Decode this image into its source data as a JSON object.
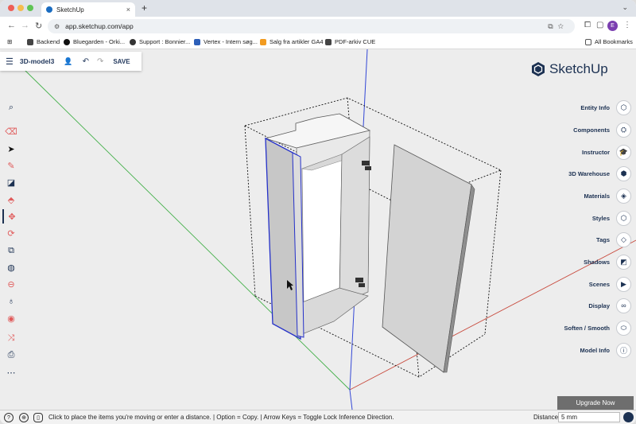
{
  "browser": {
    "tab_title": "SketchUp",
    "tab_close": "×",
    "new_tab": "+",
    "tab_menu": "⌄",
    "url": "app.sketchup.com/app",
    "avatar_initial": "E",
    "bookmarks": [
      "Backend",
      "Bluegarden - Orki...",
      "Support : Bonnier...",
      "Vertex - Intern søg...",
      "Salg fra artikler GA4",
      "PDF-arkiv CUE"
    ],
    "all_bookmarks": "All Bookmarks"
  },
  "app": {
    "file_name": "3D-model3",
    "save_label": "SAVE",
    "logo_text": "SketchUp",
    "upgrade_label": "Upgrade Now",
    "accent_color": "#1c3152"
  },
  "tools": [
    "search-icon",
    "eraser-icon",
    "select-arrow-icon",
    "pencil-icon",
    "rectangle-icon",
    "push-pull-icon",
    "move-icon",
    "rotate-icon",
    "scale-icon",
    "paint-bucket-icon",
    "tape-measure-icon",
    "orbit-icon",
    "walk-icon",
    "section-plane-icon",
    "text-icon",
    "more-icon"
  ],
  "panel": [
    "Entity Info",
    "Components",
    "Instructor",
    "3D Warehouse",
    "Materials",
    "Styles",
    "Tags",
    "Shadows",
    "Scenes",
    "Display",
    "Soften / Smooth",
    "Model Info"
  ],
  "status": {
    "message": "Click to place the items you're moving or enter a distance. | Option = Copy. | Arrow Keys = Toggle Lock Inference Direction.",
    "distance_label": "Distance",
    "distance_value": "5 mm"
  }
}
